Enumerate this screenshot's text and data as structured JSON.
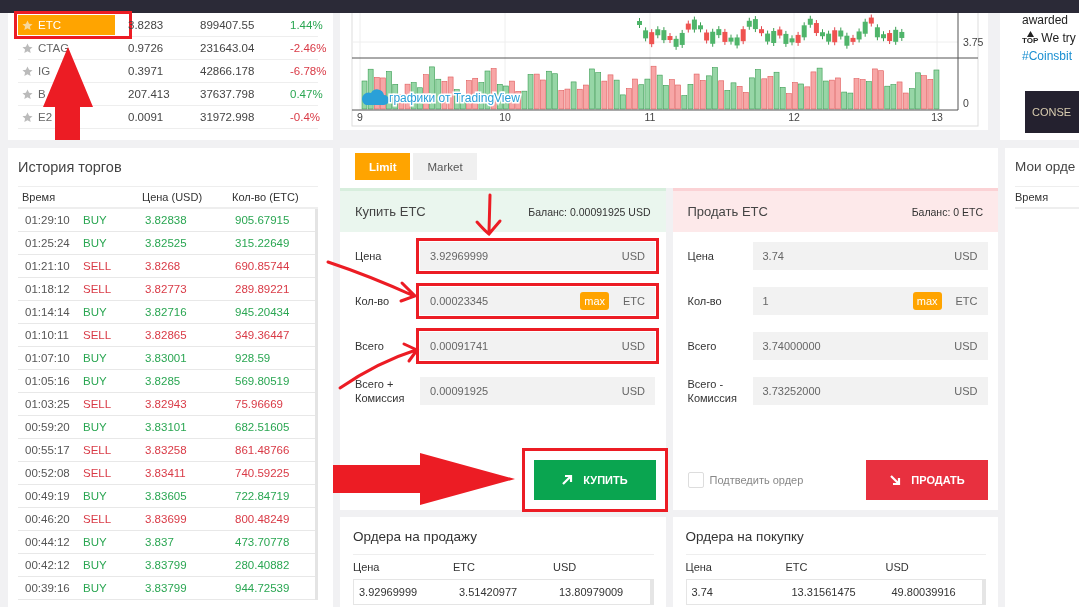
{
  "markets": [
    {
      "name": "ETC",
      "price": "3.8283",
      "volume": "899407.55",
      "change": "1.44%",
      "rising": true,
      "selected": true,
      "highlighted": true
    },
    {
      "name": "CTAG",
      "price": "0.9726",
      "volume": "231643.04",
      "change": "-2.46%",
      "rising": false,
      "selected": false,
      "highlighted": false
    },
    {
      "name": "IG",
      "price": "0.3971",
      "volume": "42866.178",
      "change": "-6.78%",
      "rising": false,
      "selected": false,
      "highlighted": false
    },
    {
      "name": "B",
      "price": "207.413",
      "volume": "37637.798",
      "change": "0.47%",
      "rising": true,
      "selected": false,
      "highlighted": false
    },
    {
      "name": "E2",
      "price": "0.0091",
      "volume": "31972.998",
      "change": "-0.4%",
      "rising": false,
      "selected": false,
      "highlighted": false
    }
  ],
  "chart": {
    "attribution": "графики от TradingView",
    "price_label": "3.75",
    "volume_label": "0",
    "x_labels": [
      "9",
      "10",
      "11",
      "12",
      "13"
    ]
  },
  "news": {
    "line_1": "awarded",
    "badge": "TOP",
    "line_2": "We try",
    "hashtag": "#Coinsbit",
    "banner": "CONSE"
  },
  "trade_history": {
    "title": "История торгов",
    "columns": [
      "Время",
      "Цена  (USD)",
      "Кол-во  (ETC)"
    ],
    "rows": [
      {
        "time": "01:29:10",
        "side": "BUY",
        "is_buy": true,
        "price": "3.82838",
        "amount": "905.67915"
      },
      {
        "time": "01:25:24",
        "side": "BUY",
        "is_buy": true,
        "price": "3.82525",
        "amount": "315.22649"
      },
      {
        "time": "01:21:10",
        "side": "SELL",
        "is_buy": false,
        "price": "3.8268",
        "amount": "690.85744"
      },
      {
        "time": "01:18:12",
        "side": "SELL",
        "is_buy": false,
        "price": "3.82773",
        "amount": "289.89221"
      },
      {
        "time": "01:14:14",
        "side": "BUY",
        "is_buy": true,
        "price": "3.82716",
        "amount": "945.20434"
      },
      {
        "time": "01:10:11",
        "side": "SELL",
        "is_buy": false,
        "price": "3.82865",
        "amount": "349.36447"
      },
      {
        "time": "01:07:10",
        "side": "BUY",
        "is_buy": true,
        "price": "3.83001",
        "amount": "928.59"
      },
      {
        "time": "01:05:16",
        "side": "BUY",
        "is_buy": true,
        "price": "3.8285",
        "amount": "569.80519"
      },
      {
        "time": "01:03:25",
        "side": "SELL",
        "is_buy": false,
        "price": "3.82943",
        "amount": "75.96669"
      },
      {
        "time": "00:59:20",
        "side": "BUY",
        "is_buy": true,
        "price": "3.83101",
        "amount": "682.51605"
      },
      {
        "time": "00:55:17",
        "side": "SELL",
        "is_buy": false,
        "price": "3.83258",
        "amount": "861.48766"
      },
      {
        "time": "00:52:08",
        "side": "SELL",
        "is_buy": false,
        "price": "3.83411",
        "amount": "740.59225"
      },
      {
        "time": "00:49:19",
        "side": "BUY",
        "is_buy": true,
        "price": "3.83605",
        "amount": "722.84719"
      },
      {
        "time": "00:46:20",
        "side": "SELL",
        "is_buy": false,
        "price": "3.83699",
        "amount": "800.48249"
      },
      {
        "time": "00:44:12",
        "side": "BUY",
        "is_buy": true,
        "price": "3.837",
        "amount": "473.70778"
      },
      {
        "time": "00:42:12",
        "side": "BUY",
        "is_buy": true,
        "price": "3.83799",
        "amount": "280.40882"
      },
      {
        "time": "00:39:16",
        "side": "BUY",
        "is_buy": true,
        "price": "3.83799",
        "amount": "944.72539"
      }
    ]
  },
  "order_form": {
    "tabs": [
      {
        "label": "Limit",
        "selected": true
      },
      {
        "label": "Market",
        "selected": false
      }
    ],
    "sides": [
      {
        "kind": "buy",
        "title": "Купить ETC",
        "balance": "Баланс: 0.00091925 USD",
        "fields": [
          {
            "label": "Цена",
            "value": "3.92969999",
            "unit": "USD",
            "highlighted": true
          },
          {
            "label": "Кол-во",
            "value": "0.00023345",
            "max": "max",
            "unit": "ETC",
            "highlighted": true
          },
          {
            "label": "Всего",
            "value": "0.00091741",
            "unit": "USD",
            "highlighted": true
          },
          {
            "label": "Всего + Комиссия",
            "value": "0.00091925",
            "unit": "USD",
            "highlighted": false
          }
        ],
        "button": {
          "label": "КУПИТЬ",
          "highlighted": true
        }
      },
      {
        "kind": "sell",
        "title": "Продать ETC",
        "balance": "Баланс: 0 ETC",
        "fields": [
          {
            "label": "Цена",
            "value": "3.74",
            "unit": "USD",
            "highlighted": false
          },
          {
            "label": "Кол-во",
            "value": "1",
            "max": "max",
            "unit": "ETC",
            "highlighted": false
          },
          {
            "label": "Всего",
            "value": "3.74000000",
            "unit": "USD",
            "highlighted": false
          },
          {
            "label": "Всего - Комиссия",
            "value": "3.73252000",
            "unit": "USD",
            "highlighted": false
          }
        ],
        "confirm": {
          "label": "Подтведить ордер",
          "checked": false
        },
        "button": {
          "label": "ПРОДАТЬ",
          "highlighted": false
        }
      }
    ]
  },
  "order_books": [
    {
      "title": "Ордера на продажу",
      "columns": [
        "Цена",
        "ETC",
        "USD"
      ],
      "rows": [
        [
          "3.92969999",
          "3.51420977",
          "13.80979009"
        ]
      ]
    },
    {
      "title": "Ордера на покупку",
      "columns": [
        "Цена",
        "ETC",
        "USD"
      ],
      "rows": [
        [
          "3.74",
          "13.31561475",
          "49.80039916"
        ]
      ]
    }
  ],
  "my_orders": {
    "title": "Мои орде",
    "columns": [
      "Время"
    ]
  },
  "annotations": [
    {
      "kind": "block-arrow"
    },
    {
      "kind": "block-arrow"
    },
    {
      "kind": "pen-arrow"
    },
    {
      "kind": "pen-arrow"
    },
    {
      "kind": "pen-arrow"
    }
  ]
}
